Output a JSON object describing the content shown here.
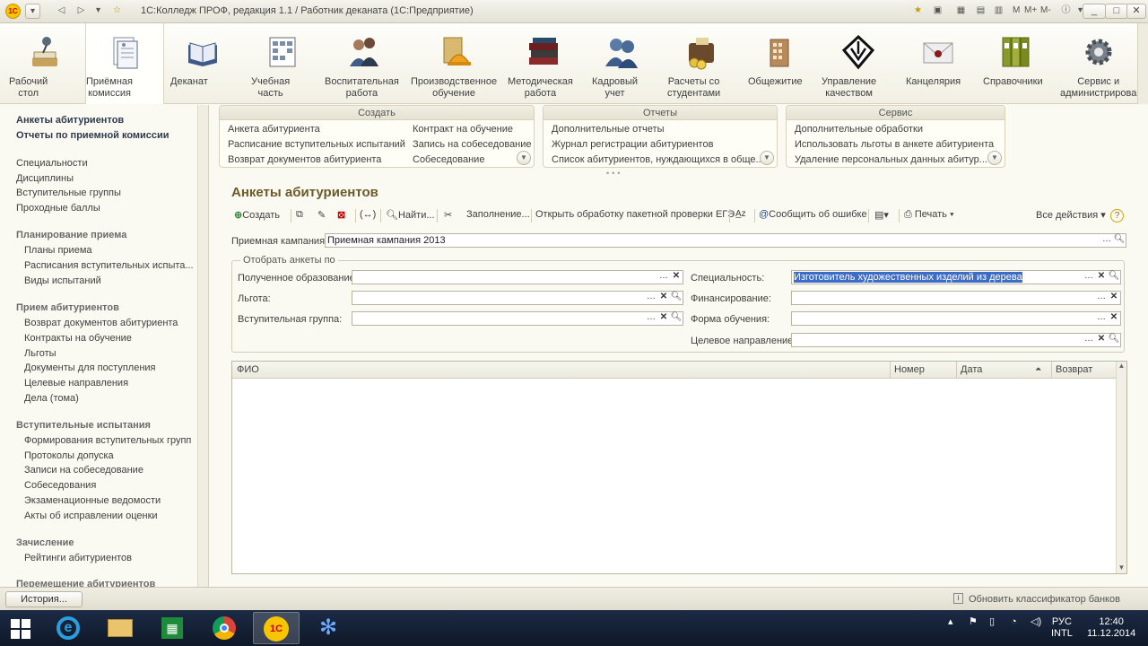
{
  "window": {
    "app_logo": "1С",
    "title": "1С:Колледж ПРОФ, редакция 1.1 / Работник деканата  (1С:Предприятие)",
    "title_icons": [
      "star-icon",
      "favorites-icon",
      "calculator-icon",
      "calendar-icon",
      "memory-icon",
      "info-icon"
    ],
    "title_letters": [
      "M",
      "M+",
      "M-"
    ],
    "controls": [
      "_",
      "□",
      "✕"
    ]
  },
  "sections": [
    {
      "label": "Рабочий\nстол",
      "icon": "desk-lamp-icon"
    },
    {
      "label": "Приёмная\nкомиссия",
      "icon": "documents-icon"
    },
    {
      "label": "Деканат",
      "icon": "book-icon"
    },
    {
      "label": "Учебная\nчасть",
      "icon": "schedule-grid-icon"
    },
    {
      "label": "Воспитательная\nработа",
      "icon": "people-icon"
    },
    {
      "label": "Производственное\nобучение",
      "icon": "helmet-icon"
    },
    {
      "label": "Методическая\nработа",
      "icon": "books-stack-icon"
    },
    {
      "label": "Кадровый\nучет",
      "icon": "staff-icon"
    },
    {
      "label": "Расчеты со\nстудентами",
      "icon": "wallet-icon"
    },
    {
      "label": "Общежитие",
      "icon": "building-icon"
    },
    {
      "label": "Управление\nкачеством",
      "icon": "quality-mark-icon"
    },
    {
      "label": "Канцелярия",
      "icon": "envelope-icon"
    },
    {
      "label": "Справочники",
      "icon": "binders-icon"
    },
    {
      "label": "Сервис и\nадминистрирова",
      "icon": "gear-icon"
    }
  ],
  "leftnav": {
    "top_links": [
      "Анкеты абитуриентов",
      "Отчеты по приемной комиссии"
    ],
    "plain_links": [
      "Специальности",
      "Дисциплины",
      "Вступительные группы",
      "Проходные баллы"
    ],
    "groups": [
      {
        "title": "Планирование приема",
        "items": [
          "Планы приема",
          "Расписания вступительных испыта...",
          "Виды испытаний"
        ]
      },
      {
        "title": "Прием абитуриентов",
        "items": [
          "Возврат документов абитуриента",
          "Контракты на обучение",
          "Льготы",
          "Документы для поступления",
          "Целевые направления",
          "Дела (тома)"
        ]
      },
      {
        "title": "Вступительные испытания",
        "items": [
          "Формирования вступительных групп",
          "Протоколы допуска",
          "Записи на собеседование",
          "Собеседования",
          "Экзаменационные ведомости",
          "Акты об исправлении оценки"
        ]
      },
      {
        "title": "Зачисление",
        "items": [
          "Рейтинги абитуриентов"
        ]
      },
      {
        "title": "Перемещение абитуриентов",
        "items": []
      }
    ]
  },
  "actions": {
    "create": {
      "title": "Создать",
      "col1": [
        "Анкета абитуриента",
        "Расписание вступительных испытаний",
        "Возврат документов абитуриента"
      ],
      "col2": [
        "Контракт на обучение",
        "Запись на собеседование",
        "Собеседование"
      ]
    },
    "reports": {
      "title": "Отчеты",
      "items": [
        "Дополнительные отчеты",
        "Журнал регистрации абитуриентов",
        "Список абитуриентов, нуждающихся в обще..."
      ]
    },
    "service": {
      "title": "Сервис",
      "items": [
        "Дополнительные обработки",
        "Использовать льготы в анкете абитуриента",
        "Удаление персональных данных абитур..."
      ]
    }
  },
  "form": {
    "title": "Анкеты абитуриентов",
    "toolbar": {
      "create": "Создать",
      "find": "Найти...",
      "fill": "Заполнение...",
      "open_processing": "Открыть обработку пакетной проверки ЕГЭ",
      "report_error": "Сообщить об ошибке",
      "print": "Печать",
      "all_actions": "Все действия"
    },
    "campaign_label": "Приемная кампания:",
    "campaign_value": "Приемная кампания 2013",
    "filter_legend": "Отобрать анкеты по",
    "filters_left": [
      {
        "label": "Полученное образование:",
        "value": ""
      },
      {
        "label": "Льгота:",
        "value": ""
      },
      {
        "label": "Вступительная группа:",
        "value": ""
      }
    ],
    "filters_right": [
      {
        "label": "Специальность:",
        "value": "Изготовитель художественных изделий из дерева"
      },
      {
        "label": "Финансирование:",
        "value": ""
      },
      {
        "label": "Форма обучения:",
        "value": ""
      },
      {
        "label": "Целевое направление:",
        "value": ""
      }
    ],
    "table": {
      "columns": [
        "ФИО",
        "Номер",
        "Дата",
        "Возврат"
      ],
      "rows": []
    }
  },
  "status": {
    "history_button": "История...",
    "message": "Обновить классификатор банков"
  },
  "taskbar": {
    "apps": [
      "windows-start-icon",
      "internet-explorer-icon",
      "file-explorer-icon",
      "store-icon",
      "chrome-icon",
      "1c-icon",
      "snowflake-app-icon"
    ],
    "lang": "РУС",
    "layout": "INTL",
    "time": "12:40",
    "date": "11.12.2014"
  },
  "colors": {
    "accent_title": "#6b5a2a",
    "selection": "#3b6cc7",
    "taskbar": "#132036"
  }
}
